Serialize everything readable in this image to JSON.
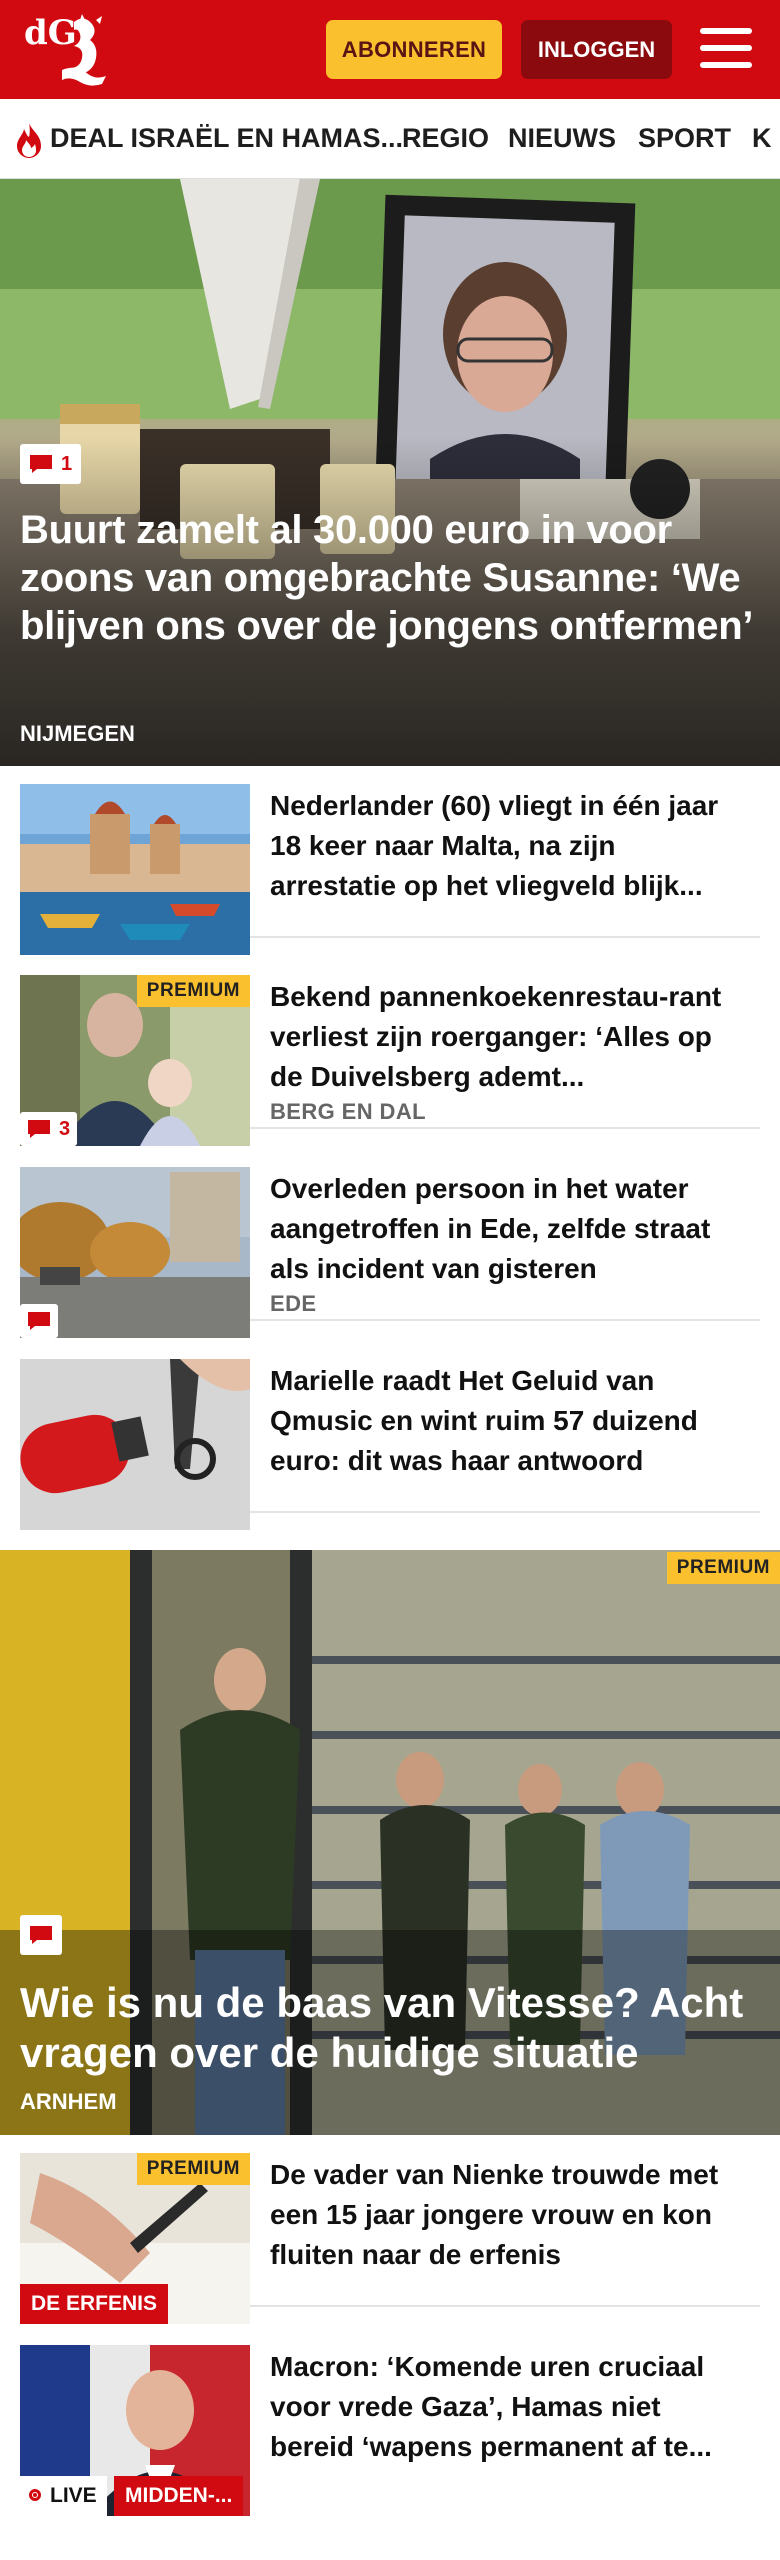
{
  "header": {
    "logo_text": "dG",
    "subscribe_label": "ABONNEREN",
    "login_label": "INLOGGEN",
    "menu_icon": "hamburger-menu-icon",
    "brand_color": "#d10a11",
    "subscribe_color": "#fbc02d"
  },
  "nav": {
    "items": [
      {
        "label": "DEAL ISRAËL EN HAMAS...",
        "icon": "flame-icon"
      },
      {
        "label": "REGIO"
      },
      {
        "label": "NIEUWS"
      },
      {
        "label": "SPORT"
      },
      {
        "label": "K"
      }
    ]
  },
  "hero": {
    "comment_count": "1",
    "title": "Buurt zamelt al 30.000 euro in voor zoons van omgebrachte Susanne: ‘We blijven ons over de jongens ontfermen’",
    "location": "NIJMEGEN"
  },
  "articles": [
    {
      "title": "Nederlander (60) vliegt in één jaar 18 keer naar Malta, na zijn arrestatie op het vliegveld blijk...",
      "location": "",
      "premium": "",
      "comments": ""
    },
    {
      "title": "Bekend pannenkoekenrestau-rant verliest zijn roerganger: ‘Alles op de Duivelsberg ademt...",
      "location": "BERG EN DAL",
      "premium": "PREMIUM",
      "comments": "3"
    },
    {
      "title": "Overleden persoon in het water aangetroffen in Ede, zelfde straat als incident van gisteren",
      "location": "EDE",
      "premium": "",
      "comments": ""
    },
    {
      "title": "Marielle raadt Het Geluid van Qmusic en wint ruim 57 duizend euro: dit was haar antwoord",
      "location": "",
      "premium": "",
      "comments": ""
    }
  ],
  "feature": {
    "premium": "PREMIUM",
    "title": "Wie is nu de baas van Vitesse? Acht vragen over de huidige situatie",
    "location": "ARNHEM"
  },
  "articles2": [
    {
      "title": "De vader van Nienke trouwde met een 15 jaar jongere vrouw en kon fluiten naar de erfenis",
      "premium": "PREMIUM",
      "tag": "DE ERFENIS"
    },
    {
      "title": "Macron: ‘Komende uren cruciaal voor vrede Gaza’, Hamas niet bereid ‘wapens permanent af te...",
      "live": "LIVE",
      "tag": "MIDDEN-..."
    }
  ]
}
